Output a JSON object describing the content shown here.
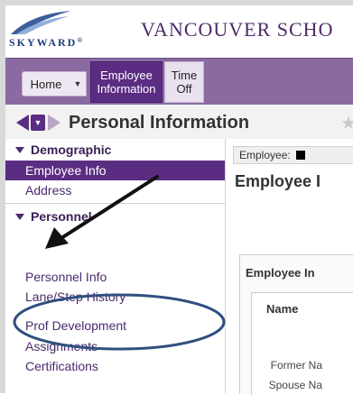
{
  "header": {
    "logo_text": "SKYWARD",
    "logo_suffix": "®",
    "school_title": "VANCOUVER SCHO"
  },
  "nav": {
    "home_label": "Home",
    "employee_info_line1": "Employee",
    "employee_info_line2": "Information",
    "time_off_line1": "Time",
    "time_off_line2": "Off"
  },
  "page": {
    "title": "Personal Information"
  },
  "sidebar": {
    "sections": [
      {
        "label": "Demographic"
      },
      {
        "label": "Personnel"
      }
    ],
    "items": [
      {
        "label": "Employee Info"
      },
      {
        "label": "Address"
      },
      {
        "label": "Personnel Info"
      },
      {
        "label": "Lane/Step History"
      },
      {
        "label": "Prof Development"
      },
      {
        "label": "Assignments"
      },
      {
        "label": "Certifications"
      }
    ]
  },
  "main": {
    "employee_label": "Employee:",
    "title": "Employee I",
    "panel_title": "Employee In",
    "name_label": "Name",
    "fields": [
      {
        "label": "Former Na"
      },
      {
        "label": "Spouse Na"
      }
    ]
  },
  "colors": {
    "brand_purple": "#5b2d82",
    "nav_bar": "#8a6aa0",
    "annotation_blue": "#2f4f7f"
  }
}
